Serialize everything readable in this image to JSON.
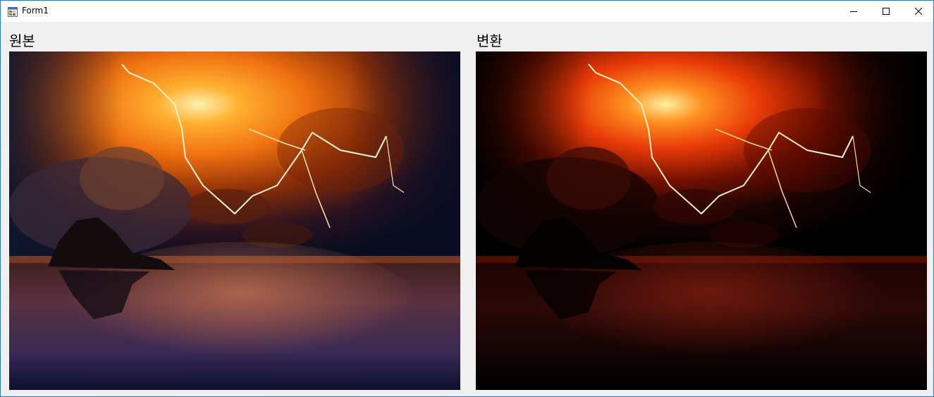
{
  "window": {
    "title": "Form1",
    "controls": {
      "minimize_icon": "minimize-icon",
      "maximize_icon": "maximize-icon",
      "close_icon": "close-icon"
    }
  },
  "labels": {
    "original": "원본",
    "converted": "변환"
  },
  "colors": {
    "title_bar": "#ffffff",
    "form_background": "#f0f0f0",
    "window_border": "#2b78c2"
  }
}
